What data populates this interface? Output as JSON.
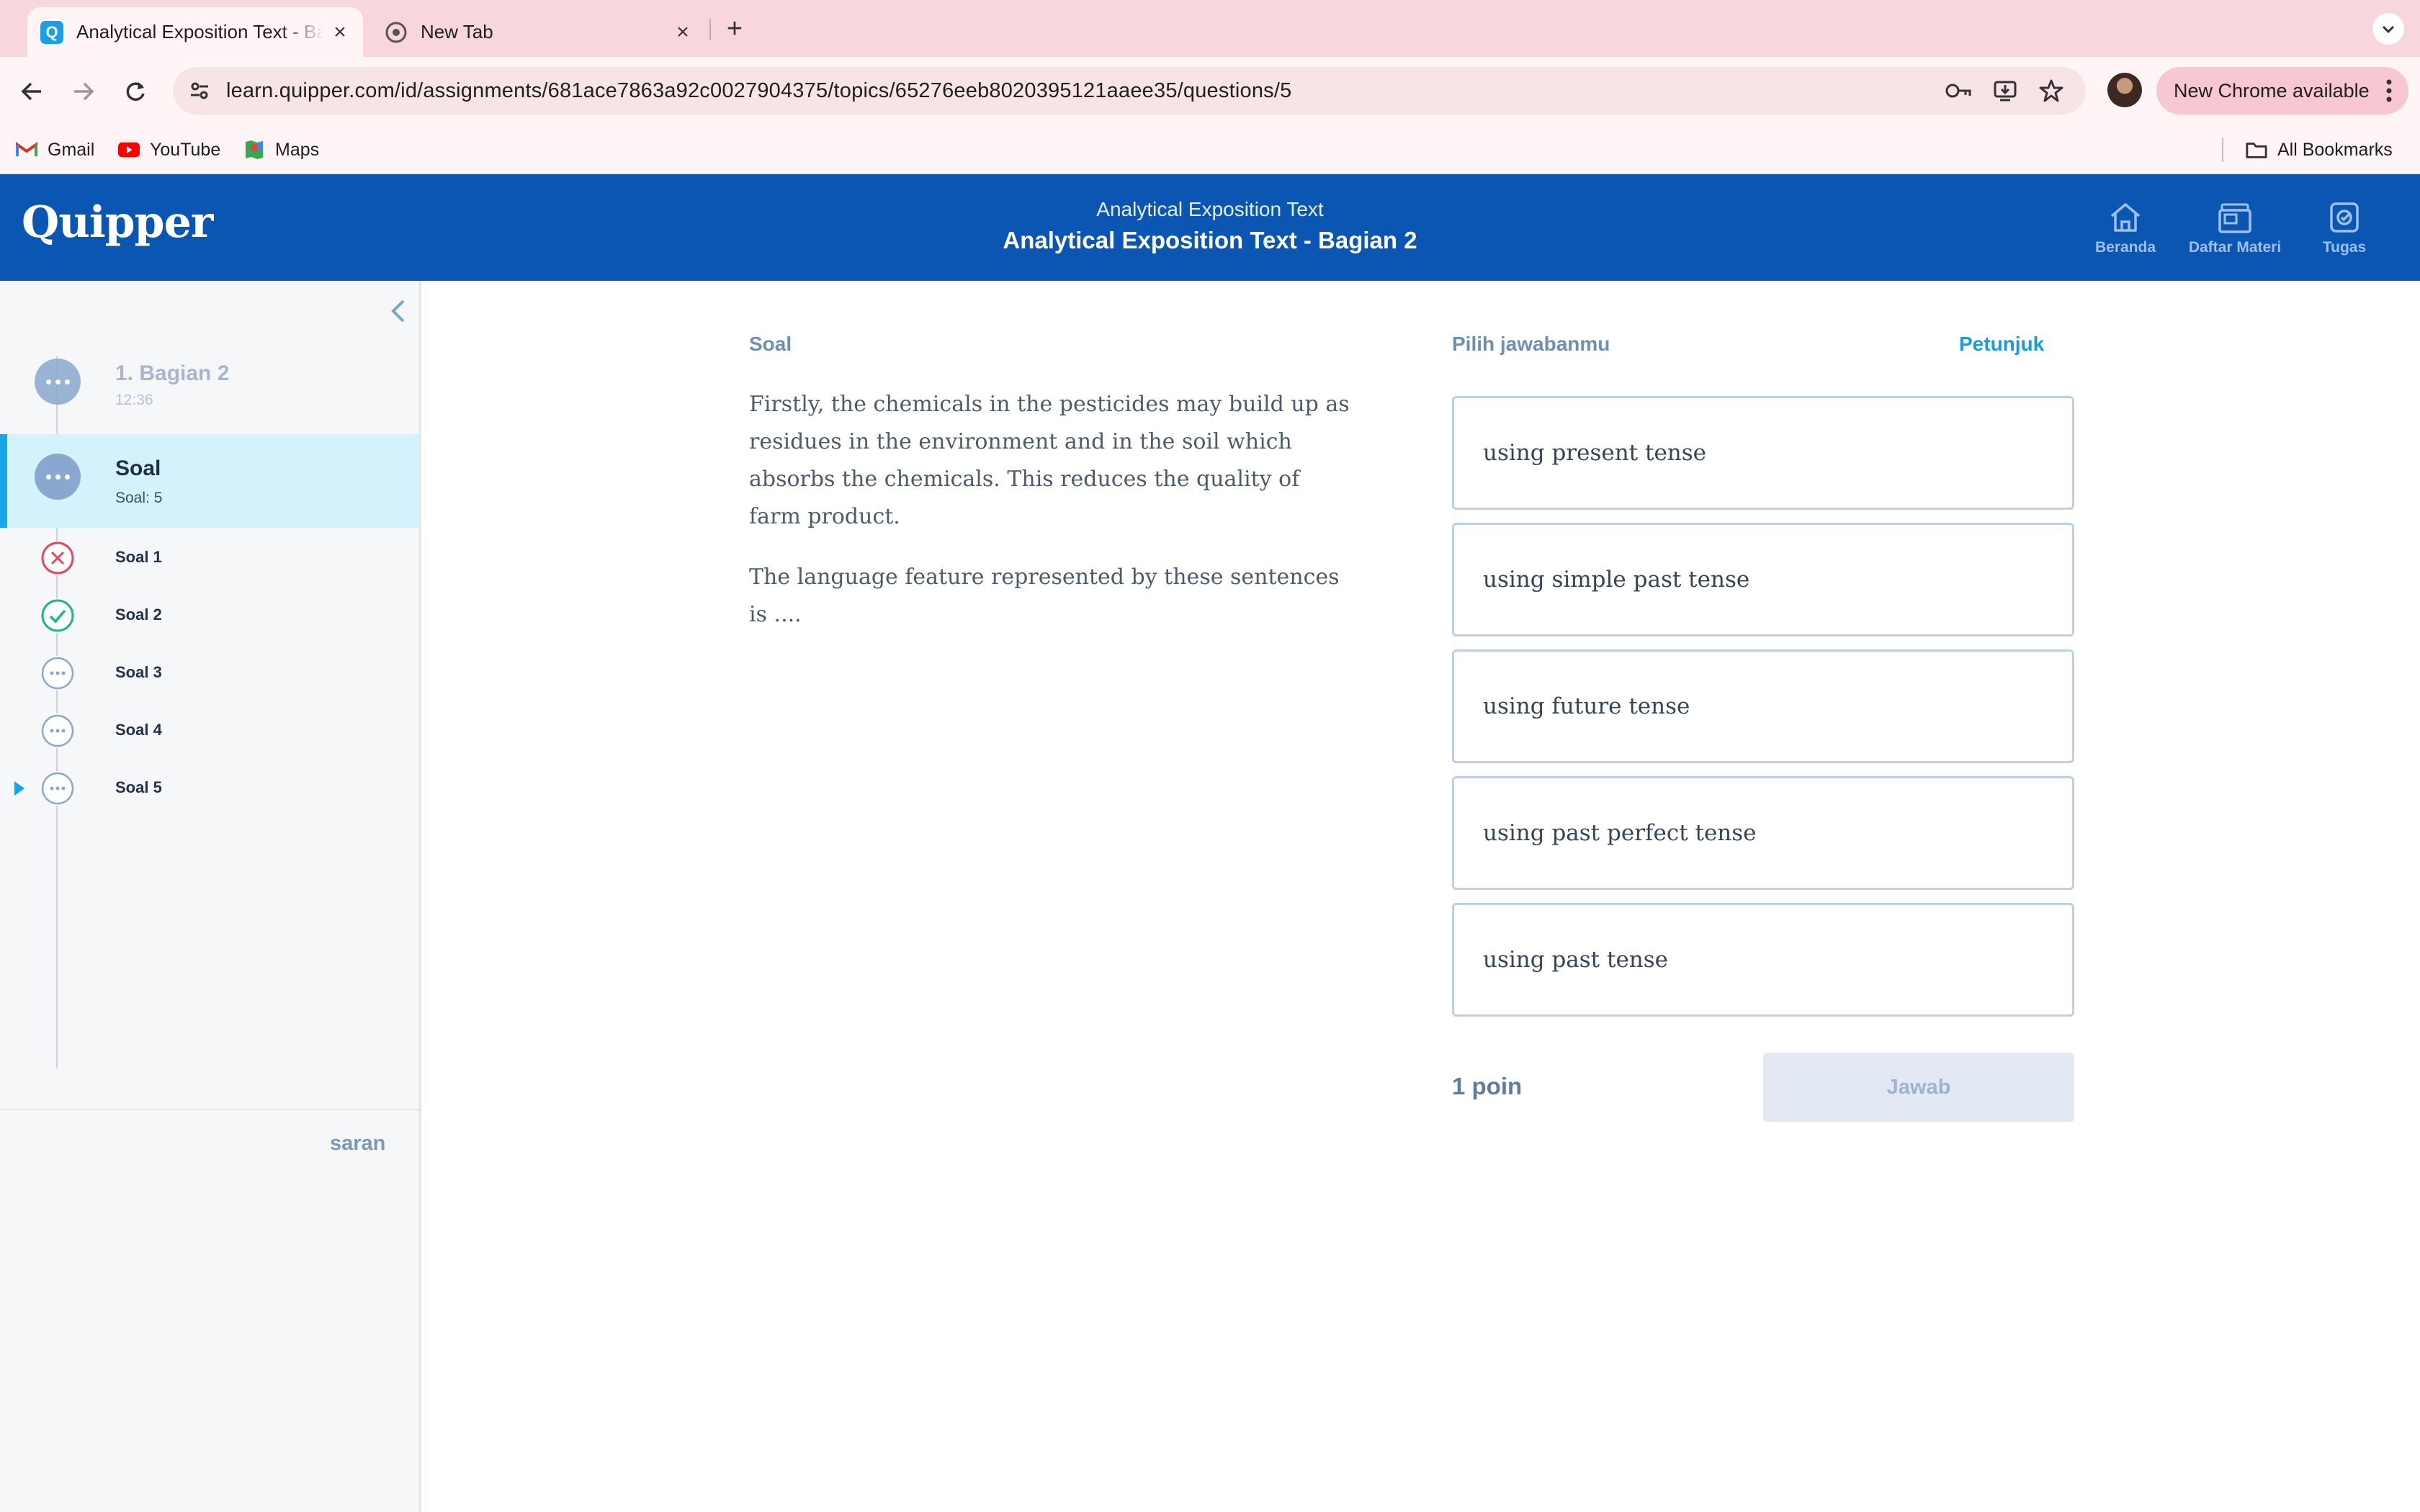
{
  "browser": {
    "tabs": [
      {
        "title": "Analytical Exposition Text - Bagian 2",
        "active": true
      },
      {
        "title": "New Tab",
        "active": false
      }
    ],
    "url": "learn.quipper.com/id/assignments/681ace7863a92c0027904375/topics/65276eeb8020395121aaee35/questions/5",
    "update_label": "New Chrome available",
    "bookmarks": [
      {
        "label": "Gmail",
        "icon": "gmail-icon"
      },
      {
        "label": "YouTube",
        "icon": "youtube-icon"
      },
      {
        "label": "Maps",
        "icon": "maps-icon"
      }
    ],
    "all_bookmarks": "All Bookmarks"
  },
  "header": {
    "logo": "Quipper",
    "subtitle": "Analytical Exposition Text",
    "title": "Analytical Exposition Text - Bagian 2",
    "nav": [
      {
        "label": "Beranda",
        "icon": "home-icon"
      },
      {
        "label": "Daftar Materi",
        "icon": "materials-icon"
      },
      {
        "label": "Tugas",
        "icon": "assignment-icon"
      }
    ]
  },
  "sidebar": {
    "section": {
      "title": "1. Bagian 2",
      "sub": "12:36"
    },
    "group": {
      "title": "Soal",
      "sub": "Soal: 5"
    },
    "items": [
      {
        "label": "Soal 1",
        "status": "wrong"
      },
      {
        "label": "Soal 2",
        "status": "correct"
      },
      {
        "label": "Soal 3",
        "status": "pending"
      },
      {
        "label": "Soal 4",
        "status": "pending"
      },
      {
        "label": "Soal 5",
        "status": "current"
      }
    ],
    "saran": "saran"
  },
  "question": {
    "label": "Soal",
    "paragraphs": [
      "Firstly, the chemicals in the pesticides may build up as residues in the environment and in the soil which absorbs the chemicals. This reduces the quality of farm product.",
      "The language feature represented by these sentences is ...."
    ]
  },
  "answers": {
    "label": "Pilih jawabanmu",
    "hint": "Petunjuk",
    "choices": [
      "using present tense",
      "using simple past tense",
      "using future tense",
      "using past perfect tense",
      "using past tense"
    ],
    "points": "1 poin",
    "submit": "Jawab"
  },
  "colors": {
    "header_bg": "#0c56b3",
    "accent": "#1aa5e8",
    "tab_bar": "#f8d6dd",
    "wrong": "#e5485d",
    "correct": "#1fb58a"
  }
}
